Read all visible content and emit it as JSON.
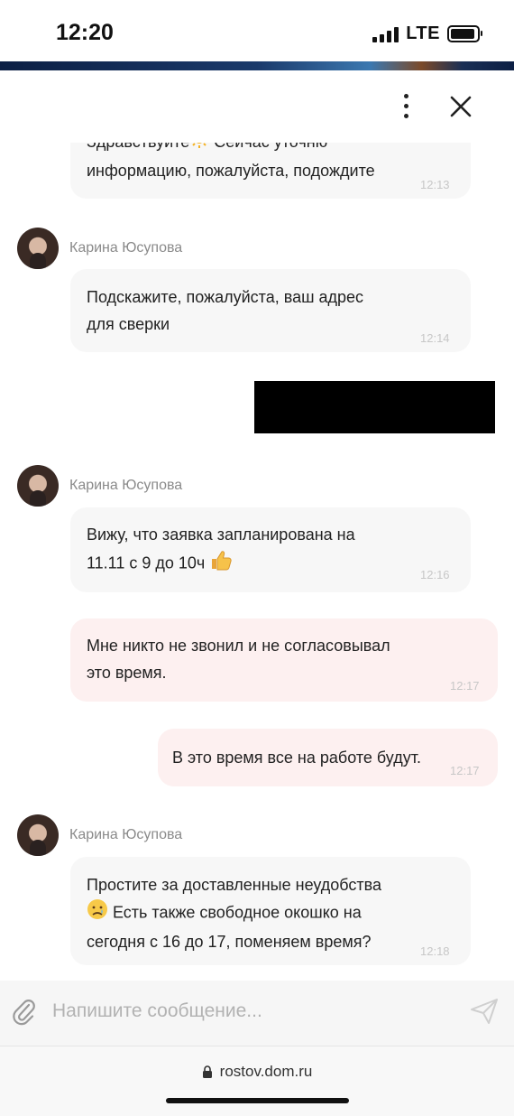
{
  "status_bar": {
    "time": "12:20",
    "network": "LTE"
  },
  "header": {
    "more_icon": "more-vertical-icon",
    "close_icon": "close-icon"
  },
  "agent": {
    "name": "Карина Юсупова"
  },
  "messages": [
    {
      "side": "incoming",
      "line1": "Здравствуйте",
      "line1_rest": " Сейчас уточню",
      "line2": "информацию, пожалуйста, подождите",
      "time": "12:13"
    },
    {
      "side": "incoming",
      "line1": "Подскажите, пожалуйста, ваш адрес",
      "line2": "для сверки",
      "time": "12:14"
    },
    {
      "side": "outgoing",
      "redacted": true
    },
    {
      "side": "incoming",
      "line1": "Вижу, что заявка запланирована на",
      "line2": "11.11 с 9 до 10ч",
      "time": "12:16"
    },
    {
      "side": "outgoing",
      "line1": "Мне никто не звонил и не согласовывал",
      "line2": "это время.",
      "time": "12:17"
    },
    {
      "side": "outgoing",
      "line1": "В это время все на работе будут.",
      "time": "12:17"
    },
    {
      "side": "incoming",
      "line1": "Простите за доставленные неудобства",
      "line2": " Есть также свободное окошко на",
      "line3": "сегодня с 16 до 17, поменяем время?",
      "time": "12:18"
    }
  ],
  "composer": {
    "placeholder": "Напишите сообщение..."
  },
  "browser": {
    "url": "rostov.dom.ru"
  },
  "colors": {
    "incoming_bubble": "#f7f7f7",
    "outgoing_bubble": "#fdf0f0",
    "timestamp": "#c7c7c7"
  }
}
